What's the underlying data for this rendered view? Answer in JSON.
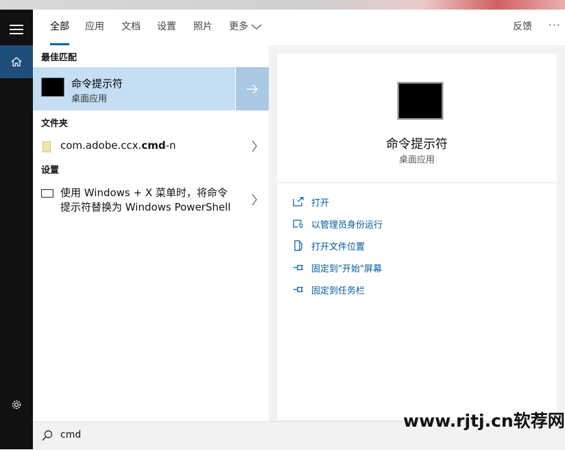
{
  "tabs": [
    "全部",
    "应用",
    "文档",
    "设置",
    "照片",
    "更多"
  ],
  "header": {
    "feedback": "反馈",
    "more_options": "···"
  },
  "sections": {
    "best_match": "最佳匹配",
    "folders": "文件夹",
    "settings": "设置"
  },
  "best_match": {
    "title": "命令提示符",
    "subtitle": "桌面应用"
  },
  "folder_item": {
    "prefix": "com.adobe.ccx.",
    "bold": "cmd",
    "suffix": "-n"
  },
  "setting_item": {
    "line1": "使用 Windows + X 菜单时，将命令",
    "line2": "提示符替换为 Windows PowerShell"
  },
  "preview": {
    "title": "命令提示符",
    "subtitle": "桌面应用"
  },
  "actions": [
    "打开",
    "以管理员身份运行",
    "打开文件位置",
    "固定到\"开始\"屏幕",
    "固定到任务栏"
  ],
  "search": {
    "query": "cmd"
  },
  "watermark": "www.rjtj.cn软荐网",
  "colors": {
    "accent": "#0063b1",
    "selected": "#c5def4",
    "link": "#005a9e"
  }
}
